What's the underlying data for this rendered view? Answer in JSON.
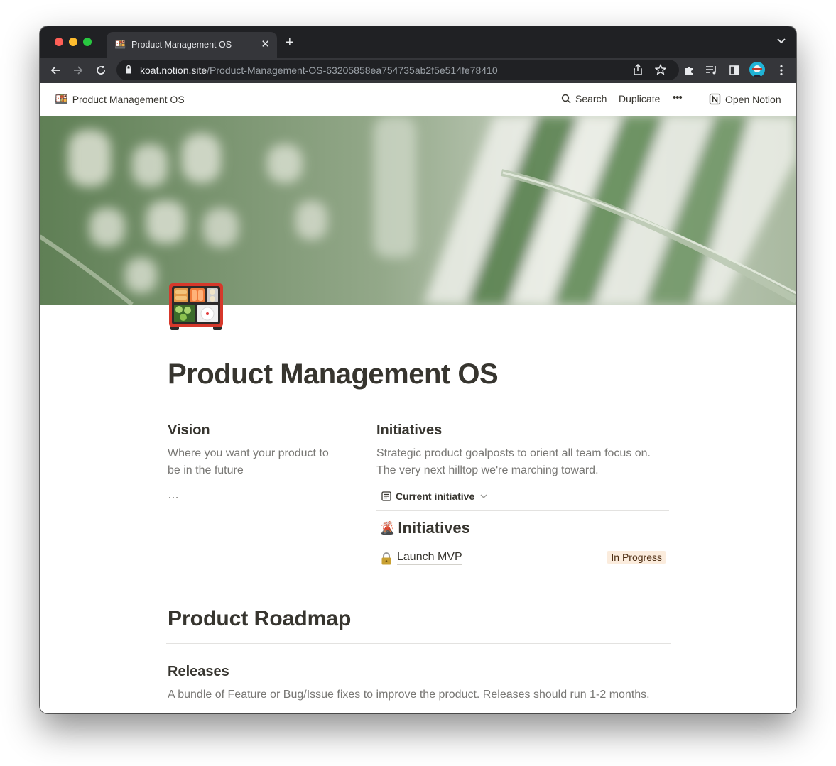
{
  "browser": {
    "tab_title": "Product Management OS",
    "tab_favicon": "bento-box-icon",
    "url_host": "koat.notion.site",
    "url_path": "/Product-Management-OS-63205858ea754735ab2f5e514fe78410"
  },
  "header": {
    "breadcrumb": "Product Management OS",
    "search_label": "Search",
    "duplicate_label": "Duplicate",
    "more_label": "•••",
    "open_notion_label": "Open Notion"
  },
  "page": {
    "icon": "bento-box-icon",
    "title": "Product Management OS"
  },
  "vision": {
    "heading": "Vision",
    "description": "Where you want your product to be in the future",
    "ellipsis": "…"
  },
  "initiatives": {
    "heading": "Initiatives",
    "description": "Strategic product goalposts to orient all team focus on. The very next hilltop we're marching toward.",
    "view_label": "Current initiative",
    "db_icon": "🌋",
    "db_title": "Initiatives",
    "items": [
      {
        "icon": "🔒",
        "name": "Launch MVP",
        "status": "In Progress"
      }
    ]
  },
  "roadmap": {
    "heading": "Product Roadmap",
    "releases_heading": "Releases",
    "releases_description": "A bundle of Feature or Bug/Issue fixes to improve the product. Releases should run 1-2 months."
  },
  "colors": {
    "tabstrip": "#202124",
    "toolbar": "#35363a",
    "text": "#37352f",
    "muted_text": "#787774",
    "badge_bg": "#fbecdd",
    "badge_text": "#49290e"
  }
}
